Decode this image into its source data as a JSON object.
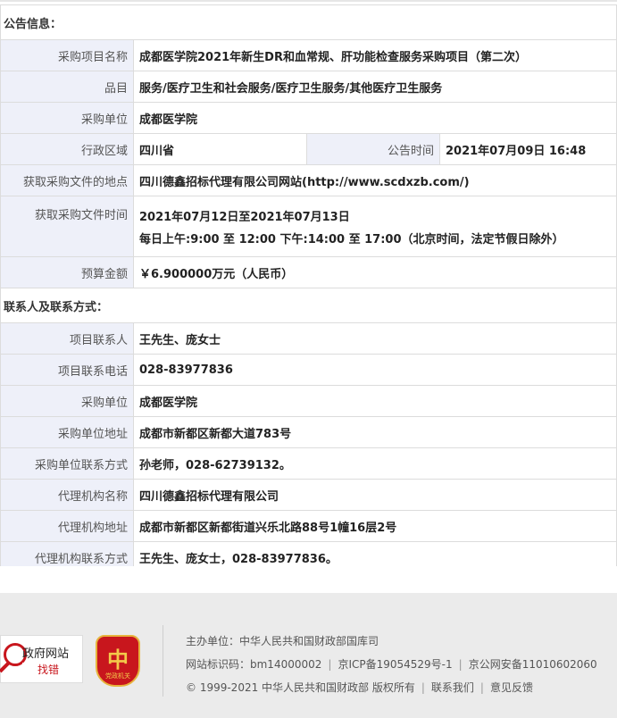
{
  "sections": {
    "notice_title": "公告信息：",
    "contact_title": "联系人及联系方式："
  },
  "notice": {
    "project_name": {
      "label": "采购项目名称",
      "value": "成都医学院2021年新生DR和血常规、肝功能检查服务采购项目（第二次）"
    },
    "category": {
      "label": "品目",
      "value": "服务/医疗卫生和社会服务/医疗卫生服务/其他医疗卫生服务"
    },
    "purchaser": {
      "label": "采购单位",
      "value": "成都医学院"
    },
    "region": {
      "label": "行政区域",
      "value": "四川省"
    },
    "publish_time": {
      "label": "公告时间",
      "value": "2021年07月09日 16:48"
    },
    "doc_place": {
      "label": "获取采购文件的地点",
      "value": "四川德鑫招标代理有限公司网站(http://www.scdxzb.com/)"
    },
    "doc_time": {
      "label": "获取采购文件时间",
      "value_line1": "2021年07月12日至2021年07月13日",
      "value_line2": "每日上午:9:00 至 12:00  下午:14:00 至 17:00（北京时间，法定节假日除外）"
    },
    "budget": {
      "label": "预算金额",
      "value": "￥6.900000万元（人民币）"
    }
  },
  "contact": {
    "project_contact": {
      "label": "项目联系人",
      "value": "王先生、庞女士"
    },
    "project_phone": {
      "label": "项目联系电话",
      "value": "028-83977836"
    },
    "purchaser": {
      "label": "采购单位",
      "value": "成都医学院"
    },
    "purchaser_address": {
      "label": "采购单位地址",
      "value": "成都市新都区新都大道783号"
    },
    "purchaser_contact": {
      "label": "采购单位联系方式",
      "value": "孙老师，028-62739132。"
    },
    "agency_name": {
      "label": "代理机构名称",
      "value": "四川德鑫招标代理有限公司"
    },
    "agency_address": {
      "label": "代理机构地址",
      "value": "成都市新都区新都街道兴乐北路88号1幢16层2号"
    },
    "agency_contact": {
      "label": "代理机构联系方式",
      "value": "王先生、庞女士，028-83977836。"
    }
  },
  "footer": {
    "gov_site_title": "政府网站",
    "gov_site_action": "找错",
    "party_badge_glyph": "中",
    "party_badge_text": "党政机关",
    "sponsor": "主办单位：中华人民共和国财政部国库司",
    "site_id": "网站标识码：bm14000002",
    "icp": "京ICP备19054529号-1",
    "police": "京公网安备11010602060",
    "copyright": "© 1999-2021 中华人民共和国财政部 版权所有",
    "contact_us": "联系我们",
    "feedback": "意见反馈",
    "accent_color": "#c8161d"
  }
}
